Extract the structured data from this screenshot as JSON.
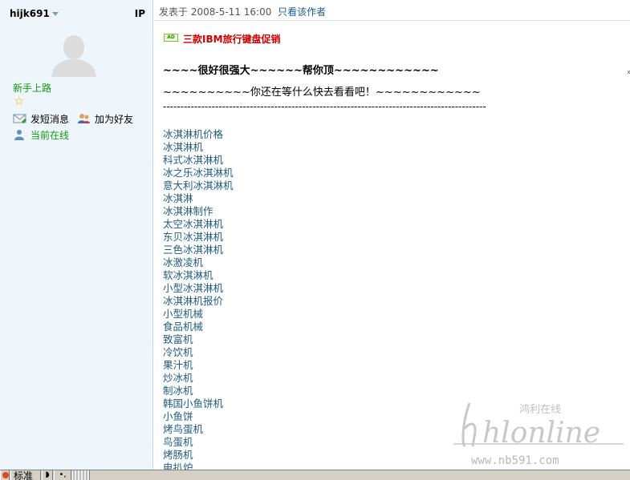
{
  "sidebar": {
    "username": "hijk691",
    "ip_label": "IP",
    "rank": "新手上路",
    "actions": {
      "send_message": "发短消息",
      "add_friend": "加为好友",
      "online_status": "当前在线"
    }
  },
  "post": {
    "posted_prefix": "发表于",
    "posted_time": "2008-5-11 16:00",
    "only_author_link": "只看该作者",
    "ad_badge": "AD",
    "ad_text": "三款IBM旅行键盘促销",
    "title": "~~~~很好很强大~~~~~~帮你顶~~~~~~~~~~~~",
    "subtitle": "~~~~~~~~~~你还在等什么快去看看吧！~~~~~~~~~~~~",
    "separator": "---------------------------------------------------------------------------------------------",
    "edge_char": "»",
    "keywords": [
      "冰淇淋机价格",
      "冰淇淋机",
      "科式冰淇淋机",
      "冰之乐冰淇淋机",
      "意大利冰淇淋机",
      "冰淇淋",
      "冰淇淋制作",
      "太空冰淇淋机",
      "东贝冰淇淋机",
      "三色冰淇淋机",
      "冰激凌机",
      "软冰淇淋机",
      "小型冰淇淋机",
      "冰淇淋机报价",
      "小型机械",
      "食品机械",
      "致富机",
      "冷饮机",
      "果汁机",
      "炒冰机",
      "制冰机",
      "韩国小鱼饼机",
      "小鱼饼",
      "烤鸟蛋机",
      "鸟蛋机",
      "烤肠机",
      "电扒炉"
    ]
  },
  "watermark": {
    "script": "hlonline",
    "tagline": "鸿利在线",
    "url": "www.nb591.com"
  },
  "taskbar": {
    "label": "标准",
    "moon": "◗",
    "dots": "•,"
  }
}
